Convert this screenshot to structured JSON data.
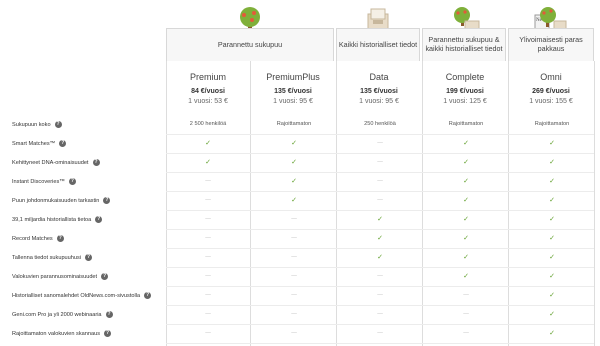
{
  "columns": [
    {
      "header": "Parannettu sukupuu",
      "plan": "Premium",
      "price": "84 €/vuosi",
      "year": "1 vuosi: 53 €",
      "icon": "tree-icon"
    },
    {
      "header": "",
      "plan": "PremiumPlus",
      "price": "135 €/vuosi",
      "year": "1 vuosi: 95 €",
      "icon": ""
    },
    {
      "header": "Kaikki historialliset tiedot",
      "plan": "Data",
      "price": "135 €/vuosi",
      "year": "1 vuosi: 95 €",
      "icon": "records-box-icon"
    },
    {
      "header": "Parannettu sukupuu & kaikki historialliset tiedot",
      "plan": "Complete",
      "price": "199 €/vuosi",
      "year": "1 vuosi: 125 €",
      "icon": "tree-box-icon"
    },
    {
      "header": "Ylivoimaisesti paras pakkaus",
      "plan": "Omni",
      "price": "269 €/vuosi",
      "year": "1 vuosi: 155 €",
      "icon": "tree-news-icon"
    }
  ],
  "newspaper_label": "News",
  "rows": [
    {
      "label": "Sukupuun koko",
      "cells": [
        "2 500 henkilöä",
        "Rajoittamaton",
        "250 henkilöä",
        "Rajoittamaton",
        "Rajoittamaton"
      ]
    },
    {
      "label": "Smart Matches™",
      "cells": [
        "✓",
        "✓",
        "—",
        "✓",
        "✓"
      ]
    },
    {
      "label": "Kehittyneet DNA-ominaisuudet",
      "cells": [
        "✓",
        "✓",
        "—",
        "✓",
        "✓"
      ]
    },
    {
      "label": "Instant Discoveries™",
      "cells": [
        "—",
        "✓",
        "—",
        "✓",
        "✓"
      ]
    },
    {
      "label": "Puun johdonmukaisuuden tarkastin",
      "cells": [
        "—",
        "✓",
        "—",
        "✓",
        "✓"
      ]
    },
    {
      "label": "39,1 miljardia historiallista tietoa",
      "cells": [
        "—",
        "—",
        "✓",
        "✓",
        "✓"
      ]
    },
    {
      "label": "Record Matches",
      "cells": [
        "—",
        "—",
        "✓",
        "✓",
        "✓"
      ]
    },
    {
      "label": "Tallenna tiedot sukupuuhusi",
      "cells": [
        "—",
        "—",
        "✓",
        "✓",
        "✓"
      ]
    },
    {
      "label": "Valokuvien parannusominaisuudet",
      "cells": [
        "—",
        "—",
        "—",
        "✓",
        "✓"
      ]
    },
    {
      "label": "Historialliset sanomalehdet OldNews.com-sivustolla",
      "cells": [
        "—",
        "—",
        "—",
        "—",
        "✓"
      ]
    },
    {
      "label": "Geni.com Pro ja yli 2000 webinaaria",
      "cells": [
        "—",
        "—",
        "—",
        "—",
        "✓"
      ]
    },
    {
      "label": "Rajoittamaton valokuvien skannaus",
      "cells": [
        "—",
        "—",
        "—",
        "—",
        "✓"
      ]
    }
  ],
  "colors": {
    "check": "#5f9e2a",
    "dash": "#bbbbbb",
    "tree_leaf": "#7fb03a",
    "trunk": "#8a5a2b",
    "box": "#e8dcc8"
  }
}
